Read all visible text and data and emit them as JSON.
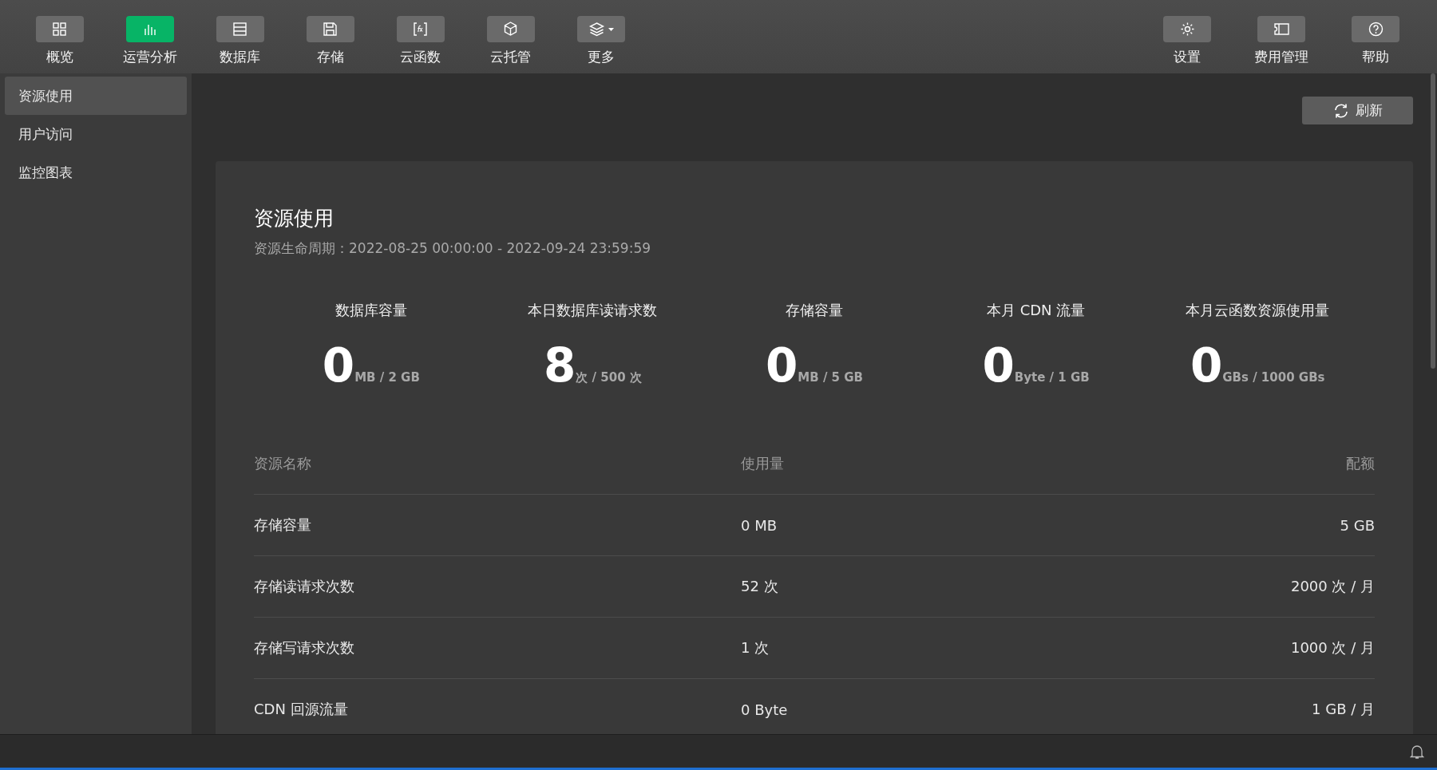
{
  "toolbar": {
    "items": [
      {
        "label": "概览",
        "selected": false
      },
      {
        "label": "运营分析",
        "selected": true
      },
      {
        "label": "数据库",
        "selected": false
      },
      {
        "label": "存储",
        "selected": false
      },
      {
        "label": "云函数",
        "selected": false
      },
      {
        "label": "云托管",
        "selected": false
      },
      {
        "label": "更多",
        "selected": false
      }
    ],
    "right_items": [
      {
        "label": "设置",
        "selected": false
      },
      {
        "label": "费用管理",
        "selected": false
      },
      {
        "label": "帮助",
        "selected": false
      }
    ]
  },
  "sidebar": {
    "items": [
      {
        "label": "资源使用",
        "selected": true
      },
      {
        "label": "用户访问",
        "selected": false
      },
      {
        "label": "监控图表",
        "selected": false
      }
    ]
  },
  "refresh_button": "刷新",
  "card": {
    "title": "资源使用",
    "subtitle": "资源生命周期：2022-08-25 00:00:00 - 2022-09-24 23:59:59",
    "stats": [
      {
        "label": "数据库容量",
        "value": "0",
        "unit": "MB / 2 GB"
      },
      {
        "label": "本日数据库读请求数",
        "value": "8",
        "unit": "次 / 500 次"
      },
      {
        "label": "存储容量",
        "value": "0",
        "unit": "MB / 5 GB"
      },
      {
        "label": "本月 CDN 流量",
        "value": "0",
        "unit": "Byte / 1 GB"
      },
      {
        "label": "本月云函数资源使用量",
        "value": "0",
        "unit": "GBs / 1000 GBs"
      }
    ],
    "table": {
      "columns": [
        "资源名称",
        "使用量",
        "配额"
      ],
      "rows": [
        [
          "存储容量",
          "0 MB",
          "5 GB"
        ],
        [
          "存储读请求次数",
          "52 次",
          "2000 次 / 月"
        ],
        [
          "存储写请求次数",
          "1 次",
          "1000 次 / 月"
        ],
        [
          "CDN 回源流量",
          "0 Byte",
          "1 GB / 月"
        ]
      ]
    }
  }
}
